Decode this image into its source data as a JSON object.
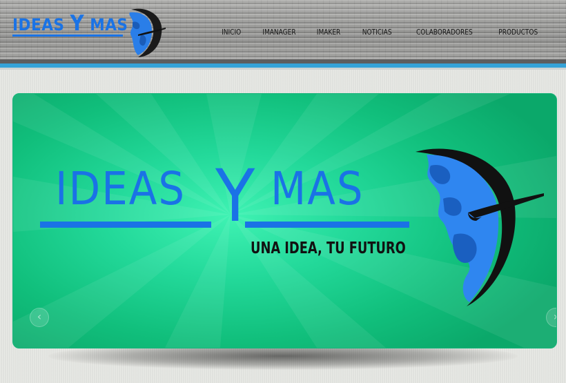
{
  "brand": {
    "logo_text_left": "IDEAS",
    "logo_text_y": "Y",
    "logo_text_right": "MAS",
    "accent_color": "#1a72e6"
  },
  "nav": {
    "items": [
      {
        "label": "INICIO"
      },
      {
        "label": "IMANAGER"
      },
      {
        "label": "IMAKER"
      },
      {
        "label": "NOTICIAS"
      },
      {
        "label": "COLABORADORES"
      },
      {
        "label": "PRODUCTOS"
      }
    ]
  },
  "slider": {
    "slide_title_left": "IDEAS",
    "slide_title_y": "Y",
    "slide_title_right": "MAS",
    "slide_tagline": "UNA IDEA, TU FUTURO",
    "prev_icon": "chevron-left-icon",
    "next_icon": "chevron-right-icon",
    "background_color": "#1fd392"
  }
}
